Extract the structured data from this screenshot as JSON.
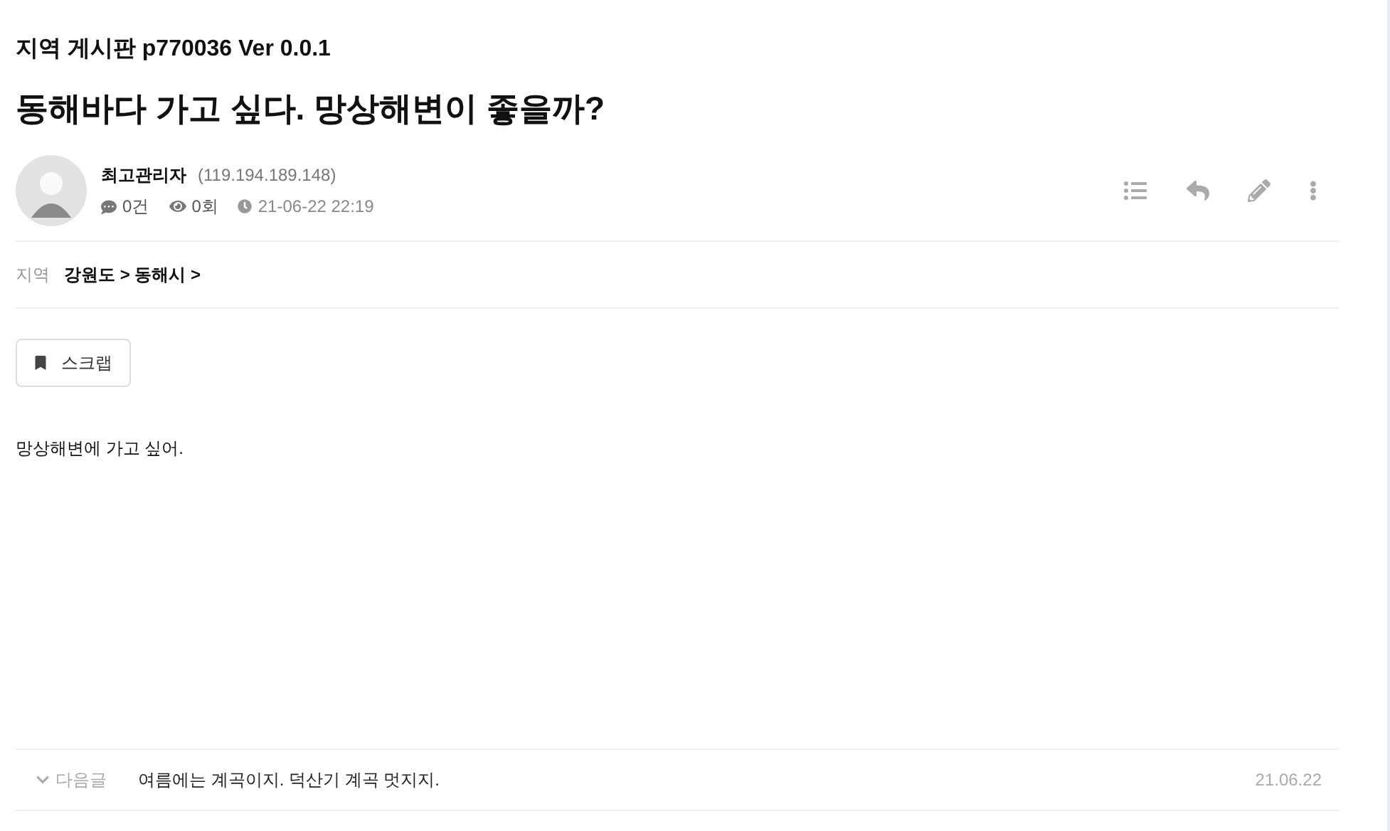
{
  "board_title": "지역 게시판 p770036 Ver 0.0.1",
  "post": {
    "title": "동해바다 가고 싶다. 망상해변이 좋을까?",
    "author": "최고관리자",
    "ip": "(119.194.189.148)",
    "comments": "0건",
    "views": "0회",
    "date": "21-06-22 22:19"
  },
  "region": {
    "label": "지역",
    "path": "강원도 > 동해시 >"
  },
  "scrap_button": "스크랩",
  "body": "망상해변에 가고 싶어.",
  "next_post": {
    "label": "다음글",
    "title": "여름에는 계곡이지. 덕산기 계곡 멋지지.",
    "date": "21.06.22"
  }
}
